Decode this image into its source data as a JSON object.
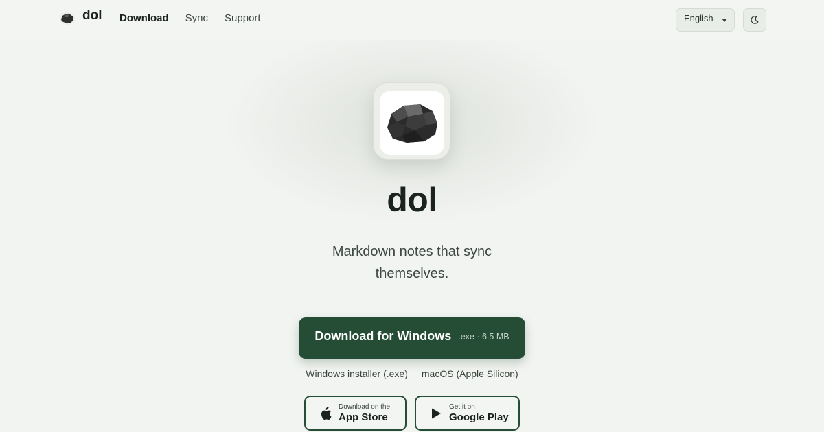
{
  "header": {
    "brand_name": "dol",
    "brand_icon": "stone-icon",
    "nav": [
      {
        "label": "Download",
        "active": true
      },
      {
        "label": "Sync",
        "active": false
      },
      {
        "label": "Support",
        "active": false
      }
    ],
    "language": "English",
    "theme_icon": "moon-icon"
  },
  "hero": {
    "app_icon": "stone-icon",
    "title": "dol",
    "tagline": "Markdown notes that sync themselves.",
    "cta_label": "Download for Windows",
    "cta_meta": ".exe · 6.5 MB",
    "alt_links": [
      "Windows installer (.exe)",
      "macOS (Apple Silicon)"
    ],
    "stores": {
      "apple": {
        "small": "Download on the",
        "big": "App Store",
        "icon": "apple-icon"
      },
      "google": {
        "small": "Get it on",
        "big": "Google Play",
        "icon": "play-icon"
      }
    }
  },
  "colors": {
    "background": "#f2f4f1",
    "accent": "#254d35",
    "text": "#1b231e"
  }
}
